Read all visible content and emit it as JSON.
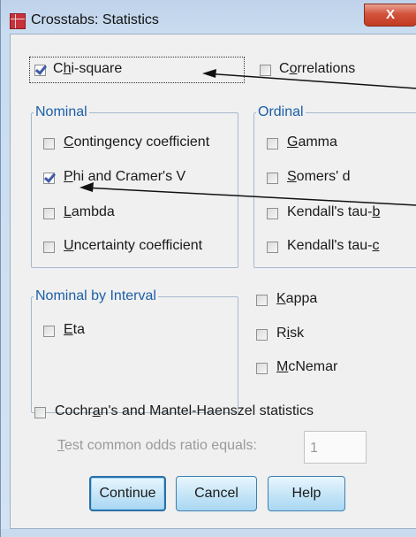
{
  "window": {
    "title": "Crosstabs: Statistics",
    "close_label": "X"
  },
  "chi_square": {
    "pre": "C",
    "u": "h",
    "post": "i-square",
    "checked": true
  },
  "correlations": {
    "pre": "C",
    "u": "o",
    "post": "rrelations",
    "checked": false
  },
  "nominal": {
    "legend": "Nominal",
    "items": [
      {
        "pre": "",
        "u": "C",
        "post": "ontingency coefficient",
        "checked": false
      },
      {
        "pre": "",
        "u": "P",
        "post": "hi and Cramer's V",
        "checked": true
      },
      {
        "pre": "",
        "u": "L",
        "post": "ambda",
        "checked": false
      },
      {
        "pre": "",
        "u": "U",
        "post": "ncertainty coefficient",
        "checked": false
      }
    ]
  },
  "ordinal": {
    "legend": "Ordinal",
    "items": [
      {
        "pre": "",
        "u": "G",
        "post": "amma",
        "checked": false
      },
      {
        "pre": "",
        "u": "S",
        "post": "omers' d",
        "checked": false
      },
      {
        "pre": "Kendall's tau-",
        "u": "b",
        "post": "",
        "checked": false
      },
      {
        "pre": "Kendall's tau-",
        "u": "c",
        "post": "",
        "checked": false
      }
    ]
  },
  "nominal_by_interval": {
    "legend": "Nominal by Interval",
    "eta": {
      "pre": "",
      "u": "E",
      "post": "ta",
      "checked": false
    }
  },
  "extras": [
    {
      "pre": "",
      "u": "K",
      "post": "appa",
      "checked": false
    },
    {
      "pre": "R",
      "u": "i",
      "post": "sk",
      "checked": false
    },
    {
      "pre": "",
      "u": "M",
      "post": "cNemar",
      "checked": false
    }
  ],
  "cochrans": {
    "pre": "Cochr",
    "u": "a",
    "post": "n's and Mantel-Haenszel statistics",
    "checked": false
  },
  "odds_ratio": {
    "pre": "",
    "u": "T",
    "post": "est common odds ratio equals:",
    "value": "1"
  },
  "buttons": {
    "continue": "Continue",
    "cancel": "Cancel",
    "help": "Help"
  }
}
